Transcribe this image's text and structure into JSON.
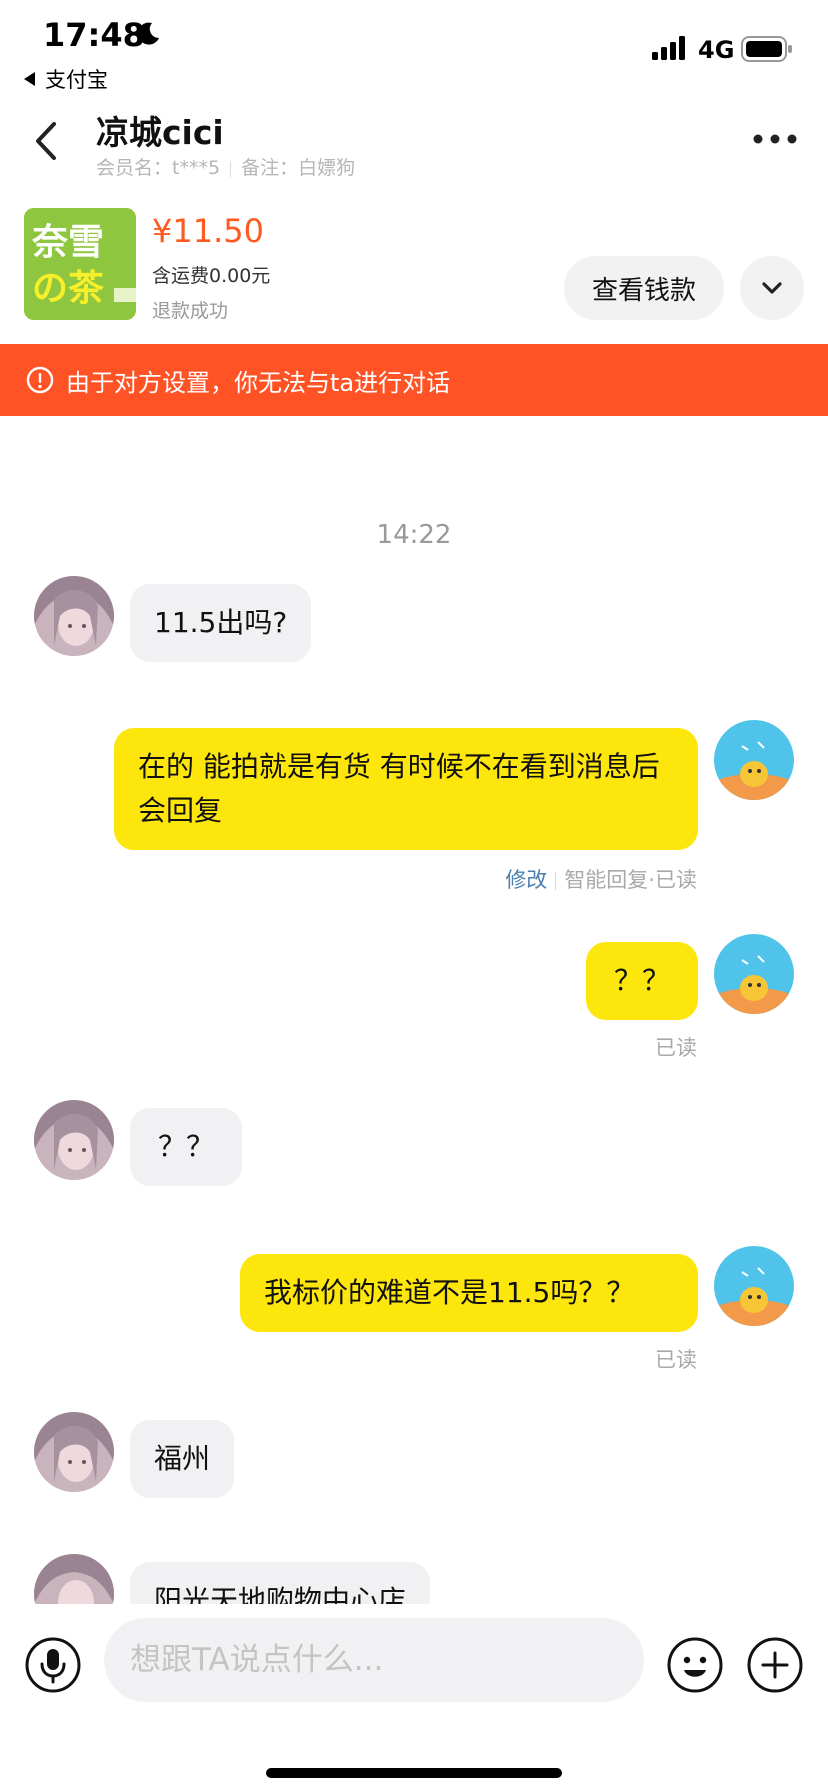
{
  "status_bar": {
    "time": "17:48",
    "network": "4G",
    "back_app": "支付宝"
  },
  "header": {
    "nickname": "凉城cici",
    "member_label": "会员名：",
    "member_value": "t***5",
    "remark_label": "备注：",
    "remark_value": "白嫖狗"
  },
  "product": {
    "thumb_text": [
      "奈雪",
      "の茶"
    ],
    "price": "¥11.50",
    "shipping": "含运费0.00元",
    "status": "退款成功",
    "view_money_label": "查看钱款"
  },
  "warning": {
    "text": "由于对方设置，你无法与ta进行对话"
  },
  "chat": {
    "timestamp": "14:22",
    "messages": [
      {
        "side": "in",
        "text": "11.5出吗?"
      },
      {
        "side": "out",
        "text": "在的 能拍就是有货 有时候不在看到消息后会回复",
        "edit_label": "修改",
        "meta": "智能回复·已读"
      },
      {
        "side": "out",
        "text": "？？",
        "meta": "已读"
      },
      {
        "side": "in",
        "text": "？？"
      },
      {
        "side": "out",
        "text": "我标价的难道不是11.5吗？？",
        "meta": "已读"
      },
      {
        "side": "in",
        "text": "福州"
      },
      {
        "side": "in",
        "text": "阳光天地购物中心店"
      }
    ]
  },
  "input": {
    "placeholder": "想跟TA说点什么..."
  },
  "colors": {
    "accent_orange": "#ff5325",
    "price_orange": "#ff5a1f",
    "bubble_yellow": "#fde60c",
    "bubble_gray": "#f1f1f4"
  }
}
